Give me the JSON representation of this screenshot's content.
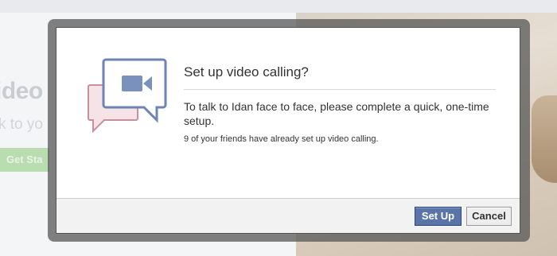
{
  "background": {
    "heading": "ideo",
    "subtext": "k to yo",
    "button_label": "Get Sta"
  },
  "dialog": {
    "title": "Set up video calling?",
    "message": "To talk to Idan face to face, please complete a quick, one-time setup.",
    "friends_note": "9 of your friends have already set up video calling.",
    "buttons": {
      "setup": "Set Up",
      "cancel": "Cancel"
    },
    "icon": "video-call-icon"
  },
  "colors": {
    "primary_button": "#5b74a8",
    "icon_blue": "#6d84b4",
    "icon_pink": "#c98f9b"
  }
}
